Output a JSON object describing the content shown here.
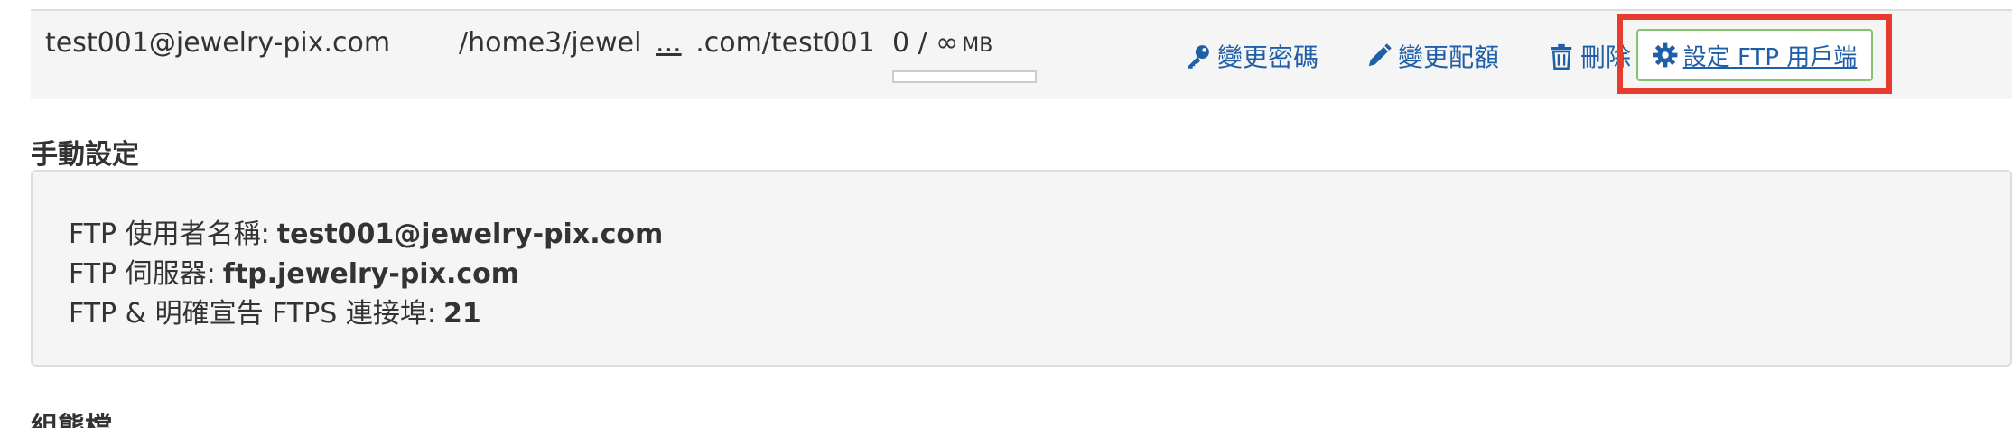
{
  "account": {
    "email": "test001@jewelry-pix.com",
    "directory_start": "/home3/jewel",
    "directory_ellipsis": "...",
    "directory_end": ".com/test001",
    "usage_text": "0 / ∞",
    "usage_unit": "MB",
    "usage_fraction": 0
  },
  "actions": {
    "change_password": "變更密碼",
    "change_quota": "變更配額",
    "delete": "刪除",
    "configure_client": "設定 FTP 用戶端"
  },
  "icons": {
    "change_password": "key-icon",
    "change_quota": "pencil-icon",
    "delete": "trash-icon",
    "configure_client": "gear-icon"
  },
  "colors": {
    "link": "#1f5fa8",
    "highlight": "#e63c2e",
    "button_border": "#82c46f",
    "panel_bg": "#f5f5f5"
  },
  "manual": {
    "title": "手動設定",
    "username_label": "FTP 使用者名稱:",
    "username_value": "test001@jewelry-pix.com",
    "server_label": "FTP 伺服器:",
    "server_value": "ftp.jewelry-pix.com",
    "port_label": "FTP & 明確宣告 FTPS 連接埠:",
    "port_value": "21"
  },
  "config": {
    "title": "組態檔"
  }
}
